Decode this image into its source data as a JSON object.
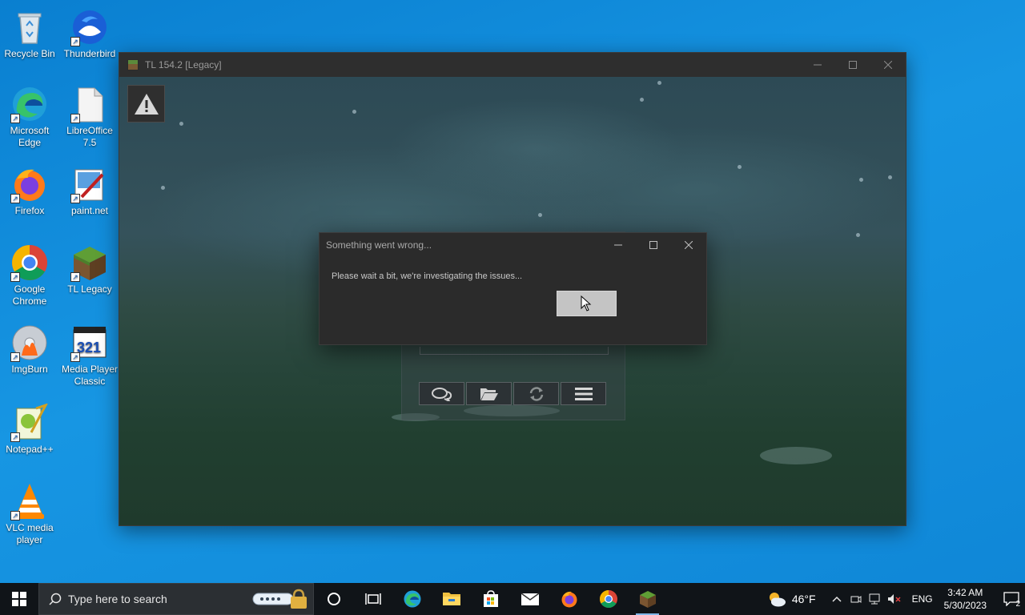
{
  "desktop": {
    "icons": [
      {
        "label": "Recycle Bin",
        "icon": "recycle-bin-icon"
      },
      {
        "label": "Thunderbird",
        "icon": "thunderbird-icon"
      },
      {
        "label": "Microsoft Edge",
        "icon": "edge-icon"
      },
      {
        "label": "LibreOffice 7.5",
        "icon": "libreoffice-icon"
      },
      {
        "label": "Firefox",
        "icon": "firefox-icon"
      },
      {
        "label": "paint.net",
        "icon": "paintnet-icon"
      },
      {
        "label": "Google Chrome",
        "icon": "chrome-icon"
      },
      {
        "label": "TL Legacy",
        "icon": "tl-legacy-icon"
      },
      {
        "label": "ImgBurn",
        "icon": "imgburn-icon"
      },
      {
        "label": "Media Player Classic",
        "icon": "media-player-classic-icon"
      },
      {
        "label": "Notepad++",
        "icon": "notepadpp-icon"
      },
      {
        "label": "VLC media player",
        "icon": "vlc-icon"
      }
    ]
  },
  "launcher": {
    "title": "TL 154.2 [Legacy]",
    "toolbar": [
      "chat-icon",
      "folder-icon",
      "refresh-icon",
      "menu-icon"
    ]
  },
  "dialog": {
    "title": "Something went wrong...",
    "message": "Please wait a bit, we're investigating the issues..."
  },
  "taskbar": {
    "search_placeholder": "Type here to search",
    "pinned": [
      "cortana-icon",
      "task-view-icon",
      "edge-icon",
      "file-explorer-icon",
      "store-icon",
      "mail-icon",
      "firefox-icon",
      "chrome-icon",
      "tl-legacy-icon"
    ],
    "weather": "46°F",
    "language": "ENG",
    "time": "3:42 AM",
    "date": "5/30/2023",
    "notification_count": "2"
  },
  "colors": {
    "desktop_bg": "#0f86d6",
    "taskbar_bg": "#101418",
    "dialog_bg": "#2b2b2b"
  }
}
